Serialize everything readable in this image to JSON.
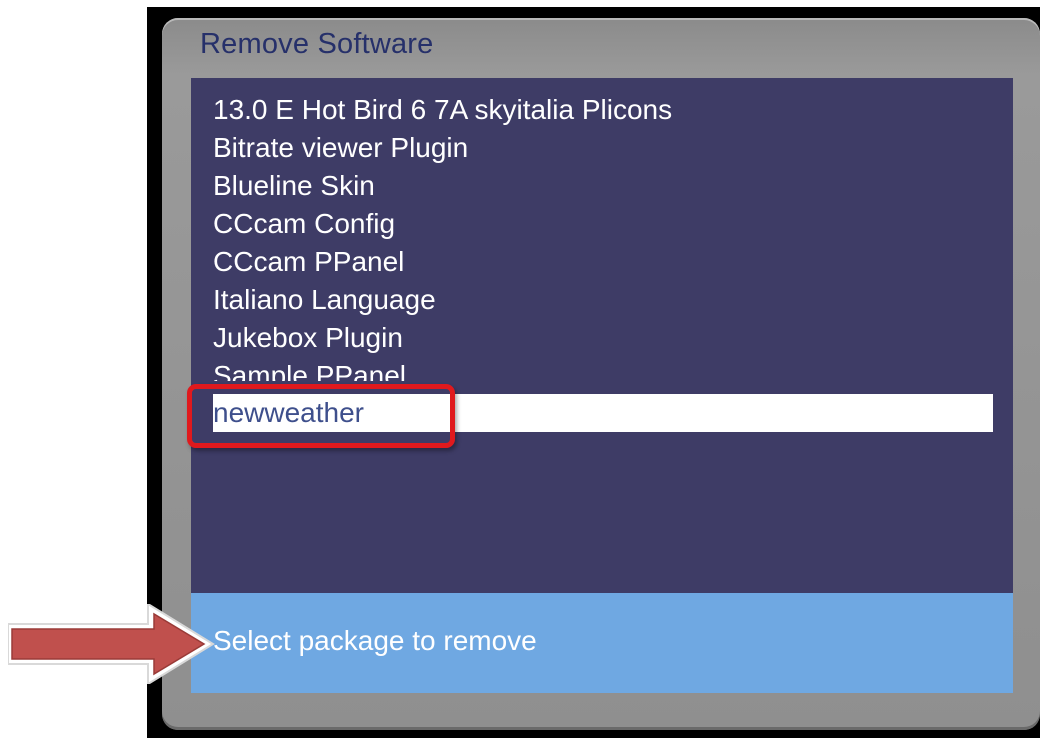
{
  "window": {
    "title": "Remove Software"
  },
  "packages": [
    {
      "label": "13.0 E Hot Bird 6 7A skyitalia Plicons",
      "selected": false
    },
    {
      "label": "Bitrate viewer Plugin",
      "selected": false
    },
    {
      "label": "Blueline Skin",
      "selected": false
    },
    {
      "label": "CCcam Config",
      "selected": false
    },
    {
      "label": "CCcam PPanel",
      "selected": false
    },
    {
      "label": "Italiano Language",
      "selected": false
    },
    {
      "label": "Jukebox Plugin",
      "selected": false
    },
    {
      "label": "Sample PPanel",
      "selected": false
    },
    {
      "label": "newweather",
      "selected": true
    }
  ],
  "status": {
    "text": "Select package to remove"
  },
  "annotations": {
    "highlight_color": "#e0191d",
    "arrow_color": "#c0504d",
    "arrow_icon": "right-arrow-icon"
  },
  "colors": {
    "list_background": "#3e3c66",
    "status_background": "#6fa8e2",
    "window_frame": "#8f8f8f",
    "title_text": "#26306a",
    "selected_text": "#3e4f8c"
  }
}
